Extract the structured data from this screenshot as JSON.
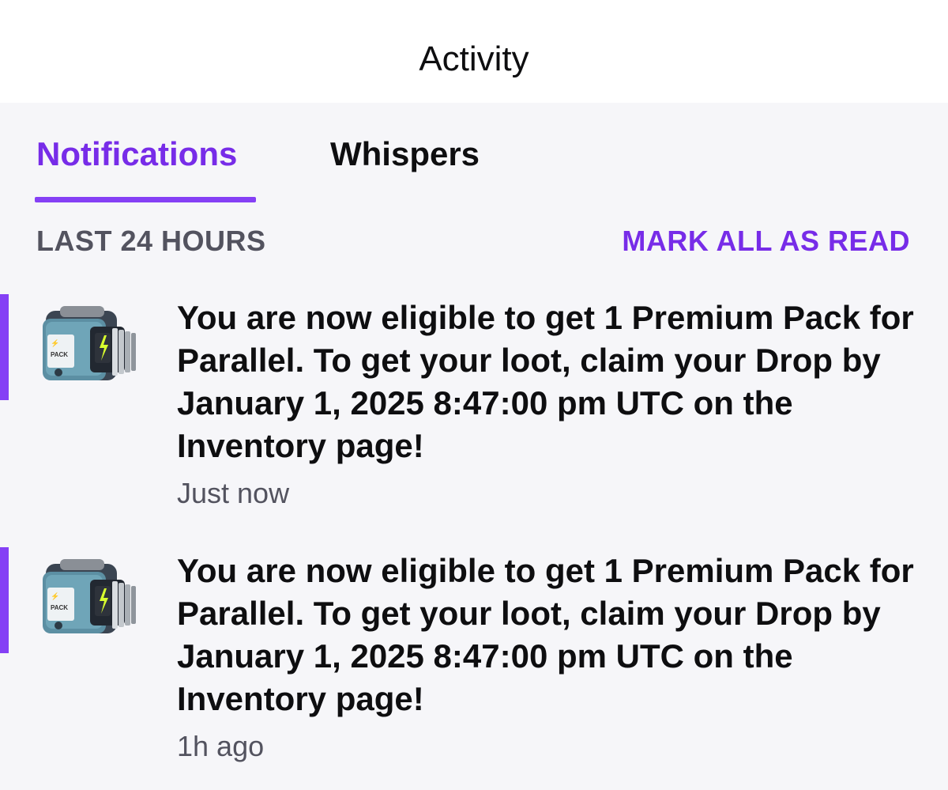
{
  "header": {
    "title": "Activity"
  },
  "tabs": [
    {
      "label": "Notifications",
      "active": true
    },
    {
      "label": "Whispers",
      "active": false
    }
  ],
  "section": {
    "label": "LAST 24 HOURS",
    "mark_all_read": "MARK ALL AS READ"
  },
  "notifications": [
    {
      "text": "You are now eligible to get 1 Premium Pack for Parallel. To get your loot, claim your Drop by January 1, 2025 8:47:00 pm UTC on the Inventory page!",
      "time": "Just now",
      "unread": true,
      "icon": "premium-pack-icon"
    },
    {
      "text": "You are now eligible to get 1 Premium Pack for Parallel. To get your loot, claim your Drop by January 1, 2025 8:47:00 pm UTC on the Inventory page!",
      "time": "1h ago",
      "unread": true,
      "icon": "premium-pack-icon"
    }
  ],
  "colors": {
    "accent": "#772ce8",
    "accent_bar": "#8540f5",
    "text_primary": "#0e0e10",
    "text_secondary": "#53535f",
    "background": "#f6f6f9"
  }
}
